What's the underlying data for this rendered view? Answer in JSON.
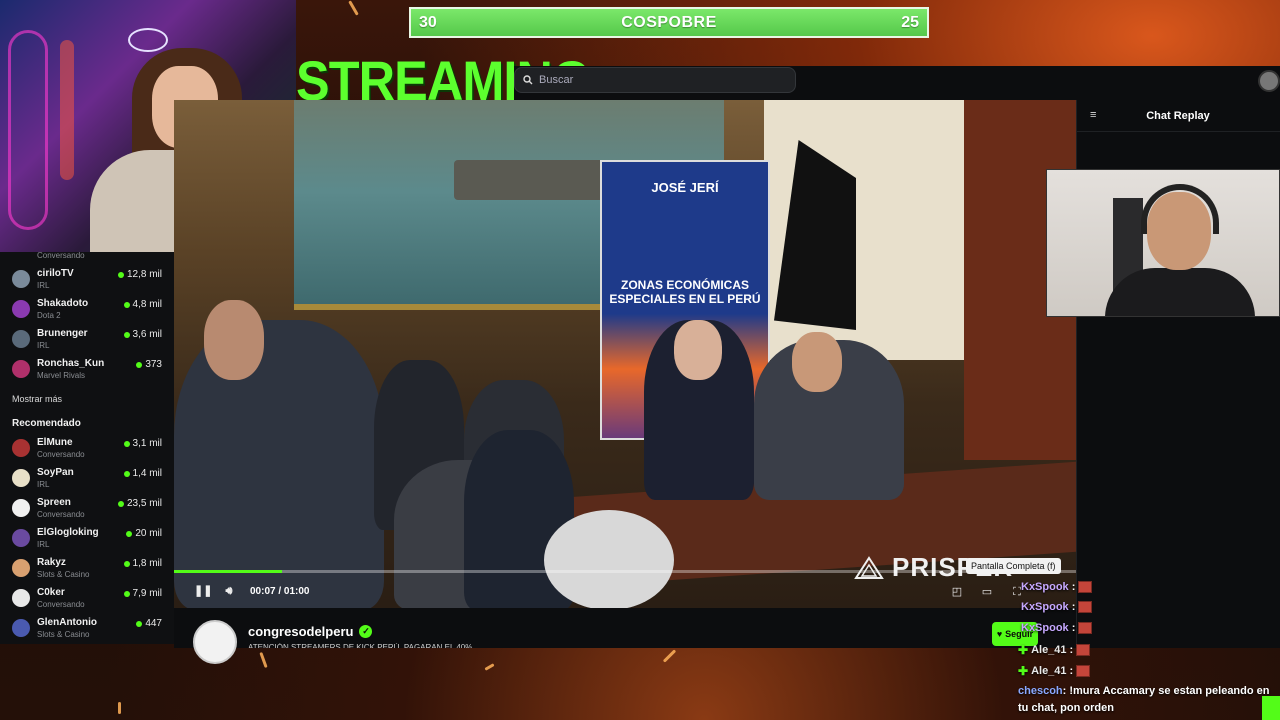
{
  "scoreboard": {
    "left_score": "30",
    "title": "COSPOBRE",
    "right_score": "25"
  },
  "overlay_title": "STREAMING",
  "search": {
    "placeholder": "Buscar",
    "icon": "search-icon"
  },
  "sidebar": {
    "top_partial_category": "Conversando",
    "following": [
      {
        "name": "ciriloTV",
        "category": "IRL",
        "viewers": "12,8 mil",
        "color": "#7a8a9a"
      },
      {
        "name": "Shakadoto",
        "category": "Dota 2",
        "viewers": "4,8 mil",
        "color": "#8a3ab0"
      },
      {
        "name": "Brunenger",
        "category": "IRL",
        "viewers": "3,6 mil",
        "color": "#5a6a7a"
      },
      {
        "name": "Ronchas_Kun",
        "category": "Marvel Rivals",
        "viewers": "373",
        "color": "#b0306a"
      }
    ],
    "show_more": "Mostrar más",
    "recommended_heading": "Recomendado",
    "recommended": [
      {
        "name": "ElMune",
        "category": "Conversando",
        "viewers": "3,1 mil",
        "color": "#a83232"
      },
      {
        "name": "SoyPan",
        "category": "IRL",
        "viewers": "1,4 mil",
        "color": "#e8e0c8"
      },
      {
        "name": "Spreen",
        "category": "Conversando",
        "viewers": "23,5 mil",
        "color": "#f0f0f0"
      },
      {
        "name": "ElGlogloking",
        "category": "IRL",
        "viewers": "20 mil",
        "color": "#6a4aa0"
      },
      {
        "name": "Rakyz",
        "category": "Slots & Casino",
        "viewers": "1,8 mil",
        "color": "#d8a070"
      },
      {
        "name": "C0ker",
        "category": "Conversando",
        "viewers": "7,9 mil",
        "color": "#e8e8e8"
      },
      {
        "name": "GlenAntonio",
        "category": "Slots & Casino",
        "viewers": "447",
        "color": "#4a5ab0"
      }
    ]
  },
  "video": {
    "banner_title": "JOSÉ JERÍ",
    "banner_subtitle": "ZONAS ECONÓMICAS ESPECIALES EN EL PERÚ",
    "watermark": "PRISPER",
    "progress_fraction": 0.12,
    "time": "00:07 / 01:00",
    "tooltip": "Pantalla Completa (f)"
  },
  "channel": {
    "name": "congresodelperu",
    "title_partial": "ATENCIÓN STREAMERS DE KICK PERÚ, PAGARAN EL 40%",
    "follow_label": "Seguir"
  },
  "chat": {
    "header": "Chat Replay",
    "overlay_lines": [
      {
        "user": "KxSpook",
        "sep": ":"
      },
      {
        "user": "KxSpook",
        "sep": ":"
      },
      {
        "user": "KxSpook",
        "sep": ":"
      },
      {
        "user": "Ale_41",
        "sep": ":"
      },
      {
        "user": "Ale_41",
        "sep": ":"
      }
    ],
    "message": {
      "user": "chescoh",
      "text": ": !mura Accamary se estan peleando en tu chat, pon orden"
    }
  },
  "colors": {
    "accent": "#53fc18",
    "streaming_text": "#5cff2e",
    "scoreboard": "#62d652"
  }
}
